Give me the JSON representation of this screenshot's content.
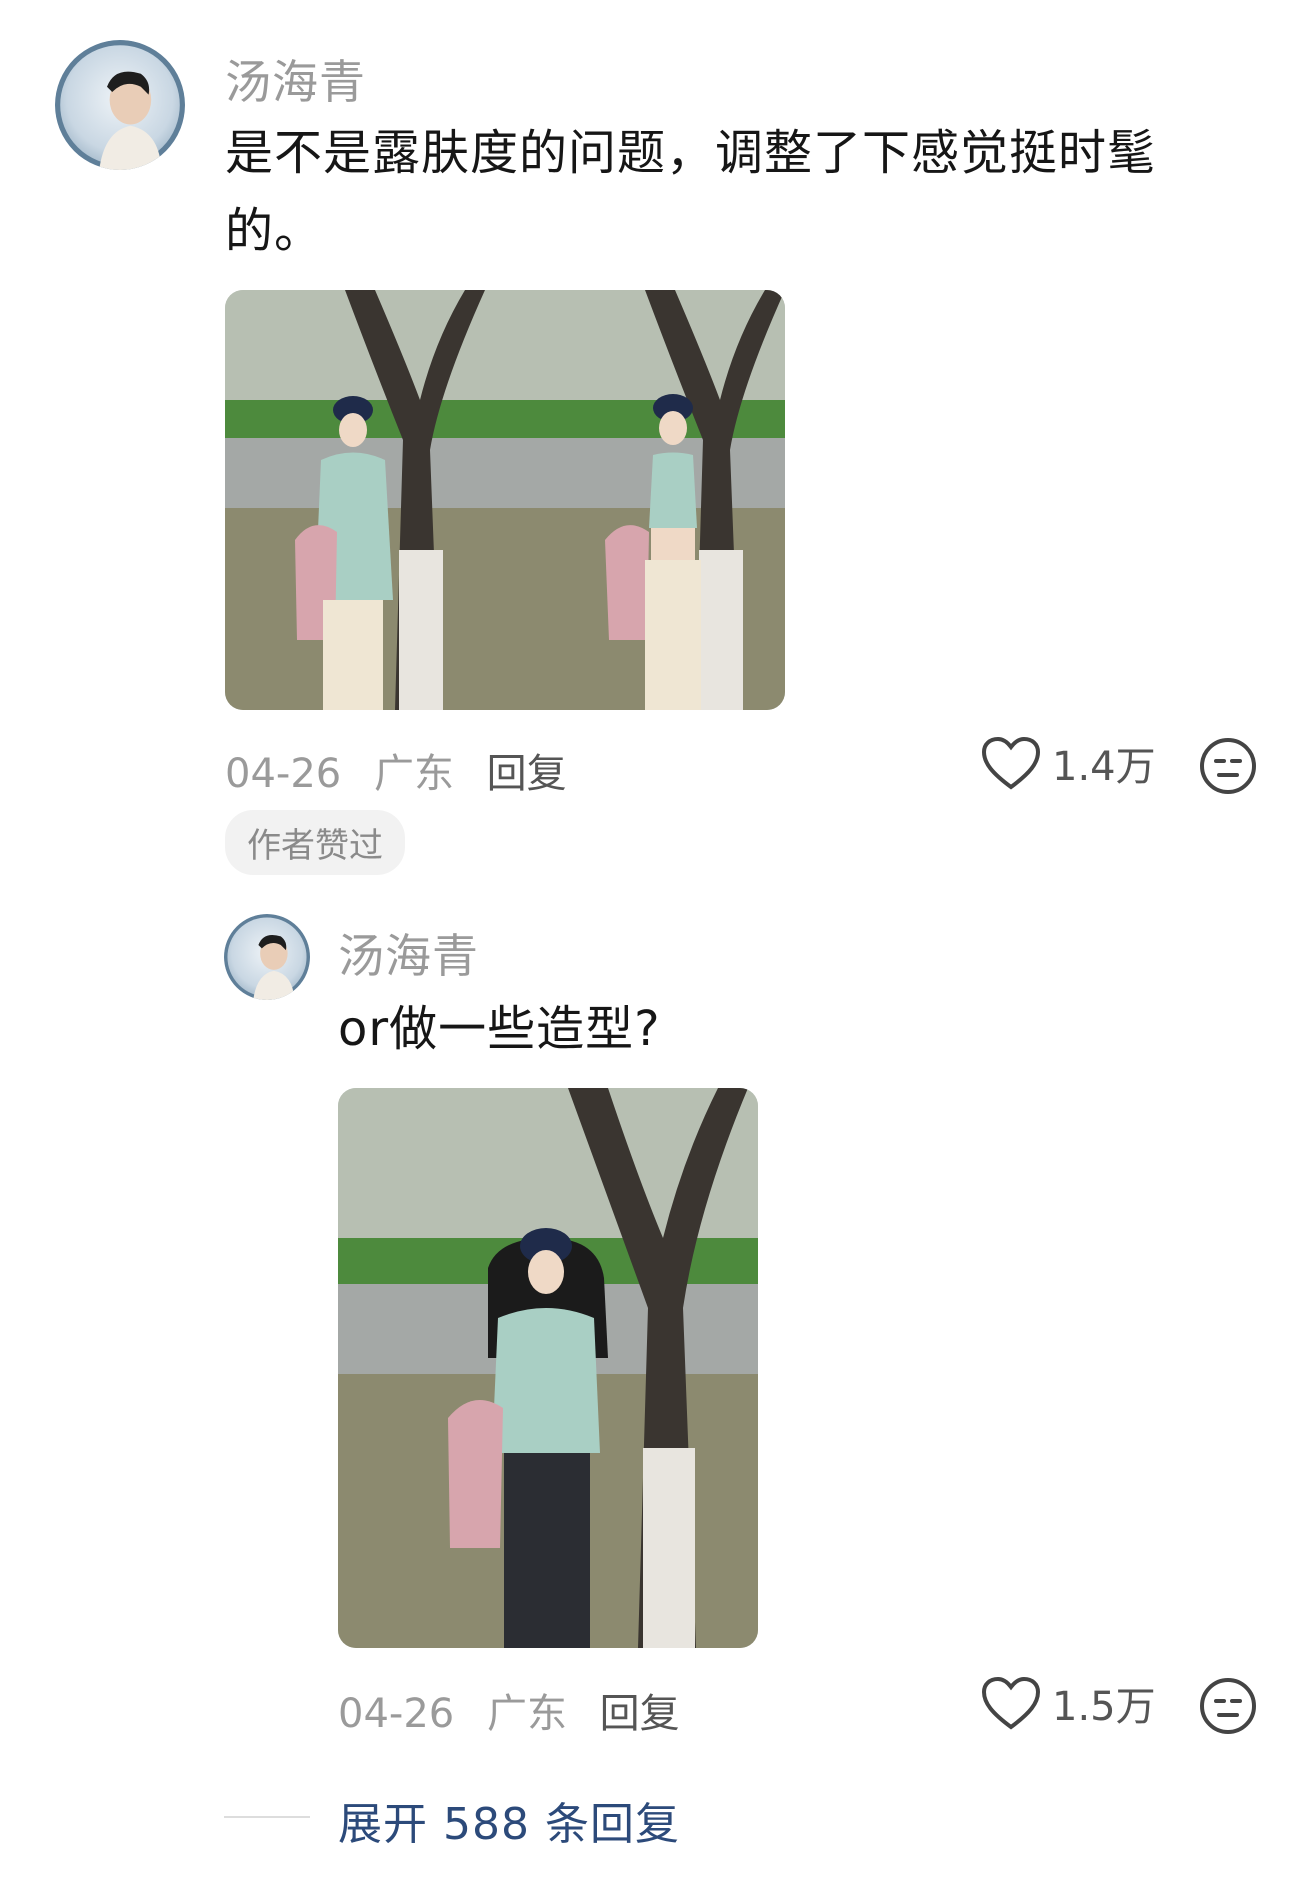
{
  "comment": {
    "username": "汤海青",
    "text_line1": "是不是露肤度的问题，调整了下感觉挺时髦",
    "text_line2": "的。",
    "date": "04-26",
    "location": "广东",
    "reply_label": "回复",
    "likes": "1.4万",
    "author_liked_badge": "作者赞过",
    "icons": [
      "avatar",
      "heart-outline-icon",
      "meh-face-icon"
    ]
  },
  "reply": {
    "username": "汤海青",
    "text": "or做一些造型?",
    "date": "04-26",
    "location": "广东",
    "reply_label": "回复",
    "likes": "1.5万"
  },
  "footer": {
    "expand_label": "展开 588 条回复"
  },
  "colors": {
    "username": "#9a9a9a",
    "text": "#161616",
    "expand_link": "#2c4a7a",
    "badge_bg": "#f2f2f2"
  }
}
